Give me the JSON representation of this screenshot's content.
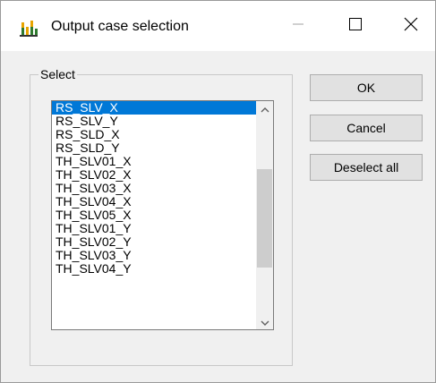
{
  "window": {
    "title": "Output case selection",
    "icon": "bar-chart-icon",
    "controls": {
      "minimize": "minimize-icon",
      "maximize": "maximize-icon",
      "close": "close-icon"
    }
  },
  "group": {
    "label": "Select"
  },
  "list": {
    "items": [
      "RS_SLV_X",
      "RS_SLV_Y",
      "RS_SLD_X",
      "RS_SLD_Y",
      "TH_SLV01_X",
      "TH_SLV02_X",
      "TH_SLV03_X",
      "TH_SLV04_X",
      "TH_SLV05_X",
      "TH_SLV01_Y",
      "TH_SLV02_Y",
      "TH_SLV03_Y",
      "TH_SLV04_Y"
    ],
    "selected_index": 0,
    "selection_color": "#0078d7"
  },
  "buttons": {
    "ok": "OK",
    "cancel": "Cancel",
    "deselect_all": "Deselect all"
  }
}
